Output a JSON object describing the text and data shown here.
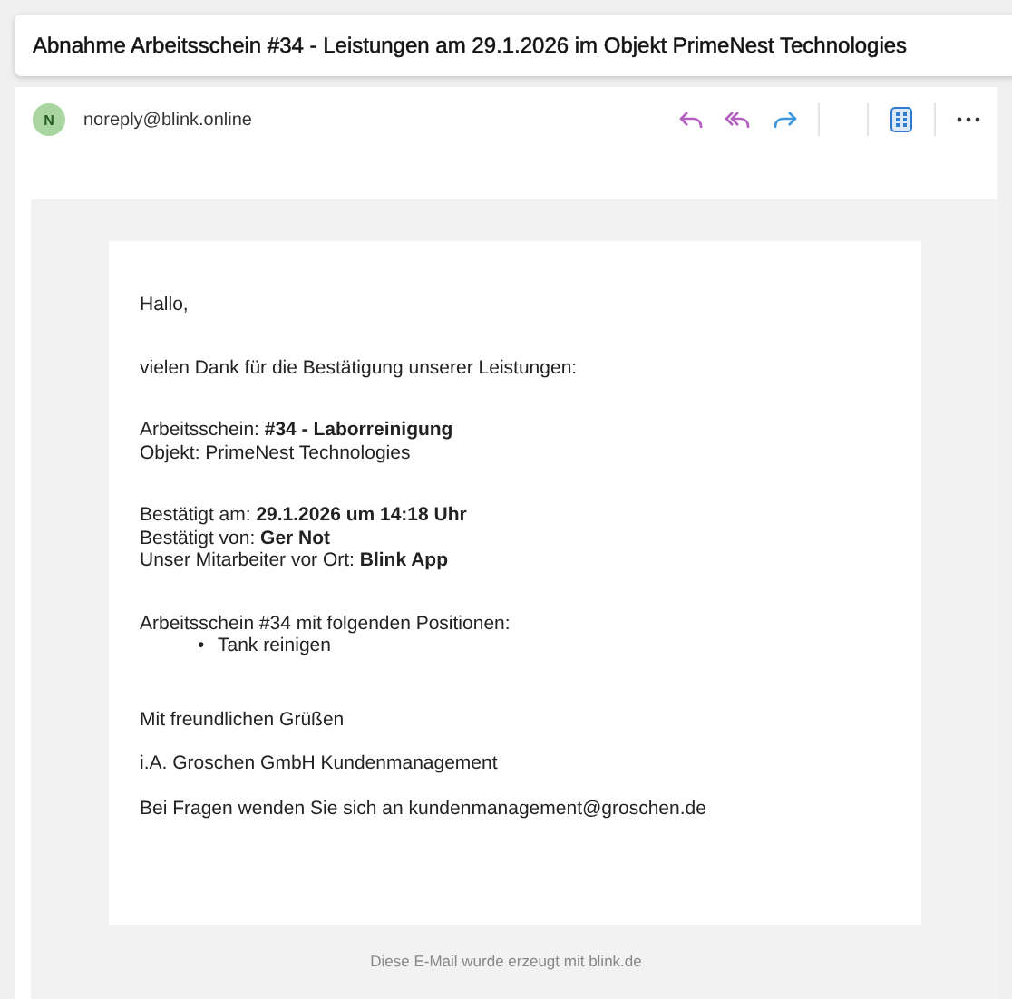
{
  "subject": "Abnahme Arbeitsschein #34 - Leistungen am 29.1.2026 im Objekt PrimeNest Technologies",
  "sender": {
    "initial": "N",
    "address": "noreply@blink.online"
  },
  "body": [
    {
      "kind": "lines",
      "lines": [
        "Hallo,"
      ]
    },
    {
      "kind": "lines",
      "lines": [
        "vielen Dank für die Bestätigung unserer Leistungen:"
      ]
    },
    {
      "kind": "lines",
      "lines": [
        "Arbeitsschein: **#34 - Laborreinigung**",
        "Objekt: PrimeNest Technologies"
      ]
    },
    {
      "kind": "lines",
      "lines": [
        "Bestätigt am: **29.1.2026 um 14:18 Uhr**",
        "Bestätigt von: **Ger Not**",
        "Unser Mitarbeiter vor Ort: **Blink App**"
      ]
    },
    {
      "kind": "list",
      "lines": [
        "Arbeitsschein #34 mit folgenden Positionen:"
      ],
      "items": [
        {
          "marker": "•",
          "text": "Tank reinigen"
        }
      ]
    },
    {
      "kind": "closing",
      "lines": [
        "Mit freundlichen Grüßen"
      ]
    },
    {
      "kind": "note",
      "lines": [
        "i.A. Groschen GmbH Kundenmanagement"
      ]
    },
    {
      "kind": "note",
      "lines": [
        "Bei Fragen wenden Sie sich an kundenmanagement@groschen.de"
      ]
    }
  ],
  "footer": "Diese E-Mail wurde erzeugt mit blink.de"
}
